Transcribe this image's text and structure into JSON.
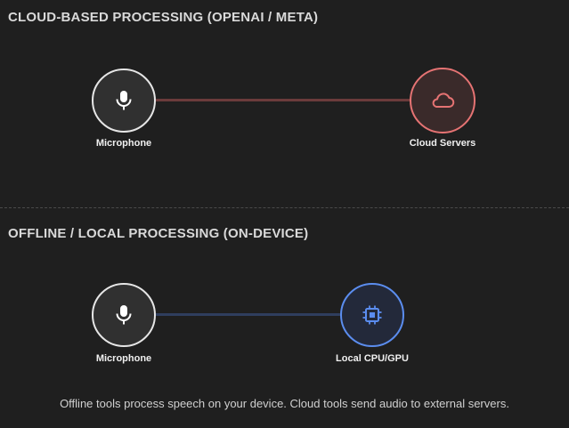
{
  "sections": {
    "cloud": {
      "title": "CLOUD-BASED PROCESSING (OPENAI / META)",
      "source_label": "Microphone",
      "target_label": "Cloud Servers"
    },
    "local": {
      "title": "OFFLINE / LOCAL PROCESSING (ON-DEVICE)",
      "source_label": "Microphone",
      "target_label": "Local CPU/GPU"
    }
  },
  "footer": "Offline tools process speech on your device. Cloud tools send audio to external servers.",
  "icons": {
    "microphone": "microphone-icon",
    "cloud": "cloud-icon",
    "cpu": "cpu-chip-icon"
  },
  "colors": {
    "background": "#1f1f1f",
    "cloud_accent": "#e57373",
    "cloud_link": "#6b3b3b",
    "local_accent": "#5b8def",
    "local_link": "#2f3e5e",
    "node_border": "#e6e6e6"
  }
}
